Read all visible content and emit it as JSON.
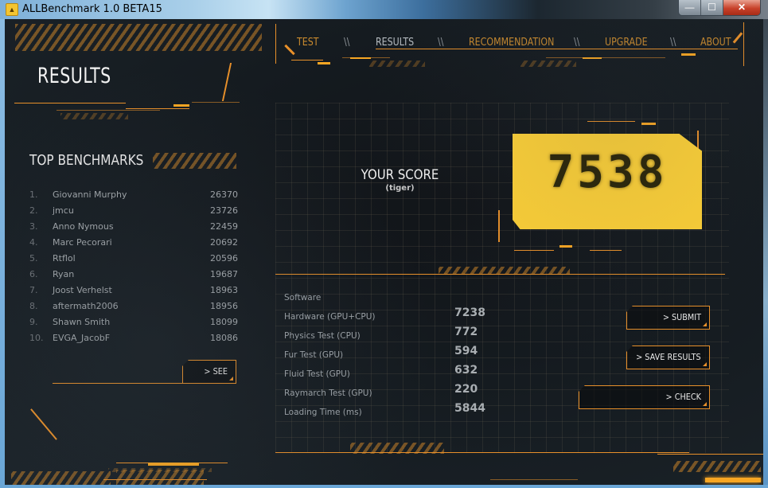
{
  "window": {
    "title": "ALLBenchmark 1.0 BETA15",
    "app_icon": "benchmark-app-icon",
    "controls": {
      "minimize": "—",
      "maximize": "☐",
      "close": "✕"
    }
  },
  "page": {
    "title": "RESULTS"
  },
  "nav": {
    "items": [
      {
        "label": "TEST",
        "active": false
      },
      {
        "label": "RESULTS",
        "active": true
      },
      {
        "label": "RECOMMENDATION",
        "active": false
      },
      {
        "label": "UPGRADE",
        "active": false
      },
      {
        "label": "ABOUT",
        "active": false
      }
    ],
    "separator": "\\\\"
  },
  "leaderboard": {
    "title": "TOP BENCHMARKS",
    "entries": [
      {
        "rank": "1.",
        "name": "Giovanni Murphy",
        "score": "26370"
      },
      {
        "rank": "2.",
        "name": "jmcu",
        "score": "23726"
      },
      {
        "rank": "3.",
        "name": "Anno Nymous",
        "score": "22459"
      },
      {
        "rank": "4.",
        "name": "Marc Pecorari",
        "score": "20692"
      },
      {
        "rank": "5.",
        "name": "Rtflol",
        "score": "20596"
      },
      {
        "rank": "6.",
        "name": "Ryan",
        "score": "19687"
      },
      {
        "rank": "7.",
        "name": "Joost Verhelst",
        "score": "18963"
      },
      {
        "rank": "8.",
        "name": "aftermath2006",
        "score": "18956"
      },
      {
        "rank": "9.",
        "name": "Shawn Smith",
        "score": "18099"
      },
      {
        "rank": "10.",
        "name": "EVGA_JacobF",
        "score": "18086"
      }
    ],
    "see_all_label": "> SEE ALL"
  },
  "score": {
    "label": "YOUR SCORE",
    "profile": "(tiger)",
    "value": "7538",
    "box_color": "#fdd037"
  },
  "results": [
    {
      "label": "Software",
      "value": ""
    },
    {
      "label": "Hardware (GPU+CPU)",
      "value": "7238"
    },
    {
      "label": "Physics Test (CPU)",
      "value": "772"
    },
    {
      "label": "Fur Test (GPU)",
      "value": "594"
    },
    {
      "label": "Fluid Test (GPU)",
      "value": "632"
    },
    {
      "label": "Raymarch Test (GPU)",
      "value": "220"
    },
    {
      "label": "Loading Time (ms)",
      "value": "5844"
    }
  ],
  "actions": {
    "submit": "> SUBMIT RESULTS",
    "save": "> SAVE RESULTS",
    "check": "> CHECK RECOMMENDATIONS"
  },
  "theme": {
    "accent": "#e8902a",
    "accent_bright": "#f7a623"
  }
}
